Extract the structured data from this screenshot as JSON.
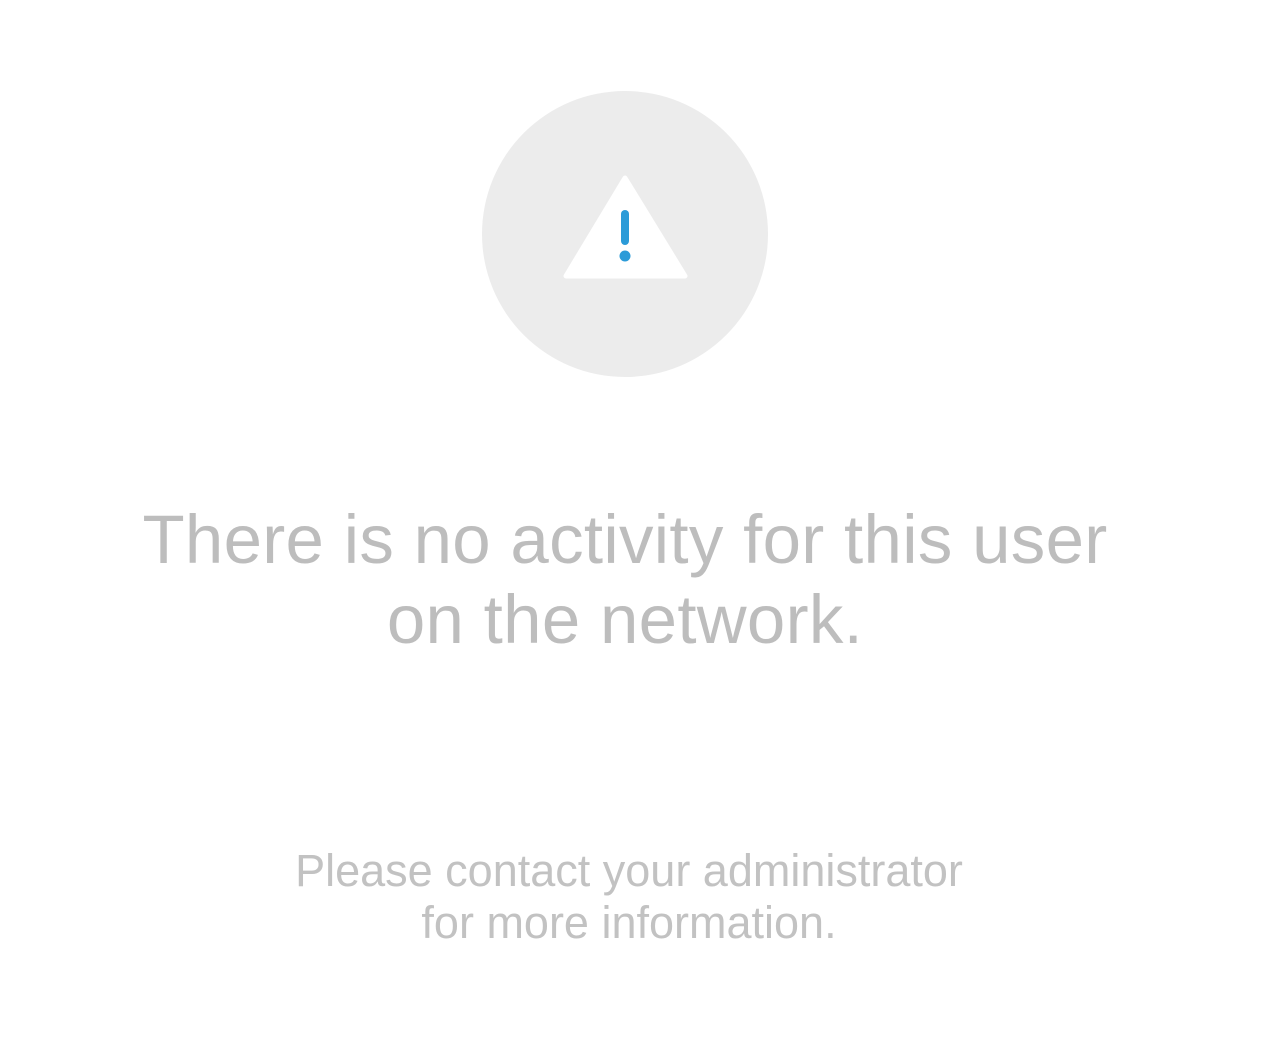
{
  "empty_state": {
    "icon": "warning-triangle-icon",
    "icon_background_color": "#ececec",
    "icon_accent_color": "#2b9bd8",
    "headline_lines": [
      "There is no activity for this user",
      "on the network."
    ],
    "subtext_lines": [
      "Please contact your administrator",
      "for more information."
    ],
    "text_color": "#bdbdbd"
  }
}
